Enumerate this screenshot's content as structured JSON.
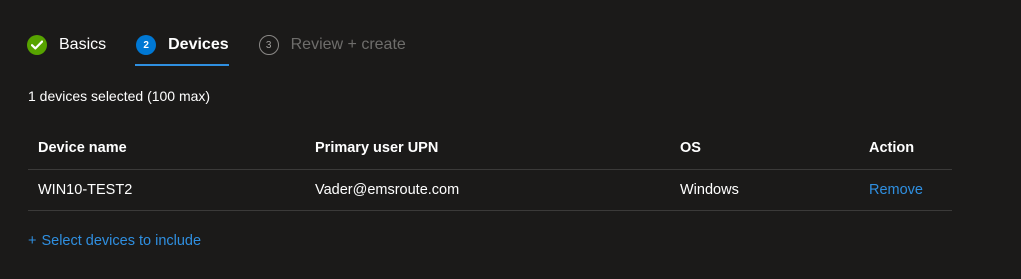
{
  "wizard": {
    "steps": [
      {
        "number": "1",
        "label": "Basics",
        "state": "done"
      },
      {
        "number": "2",
        "label": "Devices",
        "state": "current"
      },
      {
        "number": "3",
        "label": "Review + create",
        "state": "upcoming"
      }
    ]
  },
  "selection": {
    "summary": "1 devices selected (100 max)"
  },
  "table": {
    "columns": [
      "Device name",
      "Primary user UPN",
      "OS",
      "Action"
    ],
    "rows": [
      {
        "device_name": "WIN10-TEST2",
        "primary_user_upn": "Vader@emsroute.com",
        "os": "Windows",
        "action": "Remove"
      }
    ]
  },
  "actions": {
    "select_devices_plus": "+",
    "select_devices_label": "Select devices to include"
  },
  "colors": {
    "background": "#1b1a19",
    "accent": "#0078d4",
    "link": "#2f8fe0",
    "success": "#57a300",
    "divider": "#3b3a39"
  },
  "icons": {
    "done_step": "checkmark-icon"
  }
}
